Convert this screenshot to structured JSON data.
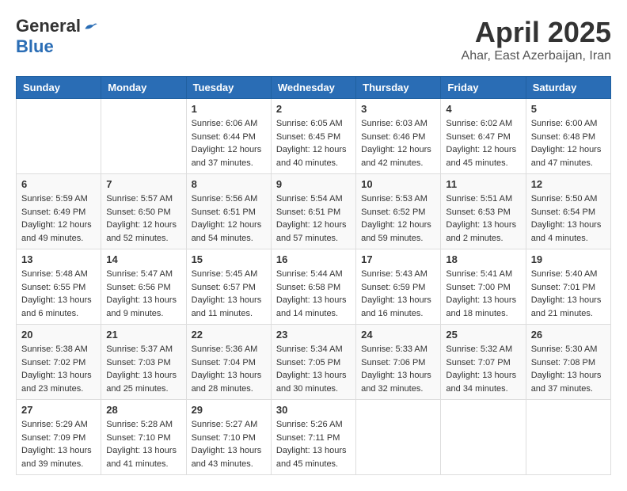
{
  "header": {
    "logo_general": "General",
    "logo_blue": "Blue",
    "month_year": "April 2025",
    "location": "Ahar, East Azerbaijan, Iran"
  },
  "calendar": {
    "days_of_week": [
      "Sunday",
      "Monday",
      "Tuesday",
      "Wednesday",
      "Thursday",
      "Friday",
      "Saturday"
    ],
    "weeks": [
      [
        {
          "day": "",
          "info": ""
        },
        {
          "day": "",
          "info": ""
        },
        {
          "day": "1",
          "info": "Sunrise: 6:06 AM\nSunset: 6:44 PM\nDaylight: 12 hours and 37 minutes."
        },
        {
          "day": "2",
          "info": "Sunrise: 6:05 AM\nSunset: 6:45 PM\nDaylight: 12 hours and 40 minutes."
        },
        {
          "day": "3",
          "info": "Sunrise: 6:03 AM\nSunset: 6:46 PM\nDaylight: 12 hours and 42 minutes."
        },
        {
          "day": "4",
          "info": "Sunrise: 6:02 AM\nSunset: 6:47 PM\nDaylight: 12 hours and 45 minutes."
        },
        {
          "day": "5",
          "info": "Sunrise: 6:00 AM\nSunset: 6:48 PM\nDaylight: 12 hours and 47 minutes."
        }
      ],
      [
        {
          "day": "6",
          "info": "Sunrise: 5:59 AM\nSunset: 6:49 PM\nDaylight: 12 hours and 49 minutes."
        },
        {
          "day": "7",
          "info": "Sunrise: 5:57 AM\nSunset: 6:50 PM\nDaylight: 12 hours and 52 minutes."
        },
        {
          "day": "8",
          "info": "Sunrise: 5:56 AM\nSunset: 6:51 PM\nDaylight: 12 hours and 54 minutes."
        },
        {
          "day": "9",
          "info": "Sunrise: 5:54 AM\nSunset: 6:51 PM\nDaylight: 12 hours and 57 minutes."
        },
        {
          "day": "10",
          "info": "Sunrise: 5:53 AM\nSunset: 6:52 PM\nDaylight: 12 hours and 59 minutes."
        },
        {
          "day": "11",
          "info": "Sunrise: 5:51 AM\nSunset: 6:53 PM\nDaylight: 13 hours and 2 minutes."
        },
        {
          "day": "12",
          "info": "Sunrise: 5:50 AM\nSunset: 6:54 PM\nDaylight: 13 hours and 4 minutes."
        }
      ],
      [
        {
          "day": "13",
          "info": "Sunrise: 5:48 AM\nSunset: 6:55 PM\nDaylight: 13 hours and 6 minutes."
        },
        {
          "day": "14",
          "info": "Sunrise: 5:47 AM\nSunset: 6:56 PM\nDaylight: 13 hours and 9 minutes."
        },
        {
          "day": "15",
          "info": "Sunrise: 5:45 AM\nSunset: 6:57 PM\nDaylight: 13 hours and 11 minutes."
        },
        {
          "day": "16",
          "info": "Sunrise: 5:44 AM\nSunset: 6:58 PM\nDaylight: 13 hours and 14 minutes."
        },
        {
          "day": "17",
          "info": "Sunrise: 5:43 AM\nSunset: 6:59 PM\nDaylight: 13 hours and 16 minutes."
        },
        {
          "day": "18",
          "info": "Sunrise: 5:41 AM\nSunset: 7:00 PM\nDaylight: 13 hours and 18 minutes."
        },
        {
          "day": "19",
          "info": "Sunrise: 5:40 AM\nSunset: 7:01 PM\nDaylight: 13 hours and 21 minutes."
        }
      ],
      [
        {
          "day": "20",
          "info": "Sunrise: 5:38 AM\nSunset: 7:02 PM\nDaylight: 13 hours and 23 minutes."
        },
        {
          "day": "21",
          "info": "Sunrise: 5:37 AM\nSunset: 7:03 PM\nDaylight: 13 hours and 25 minutes."
        },
        {
          "day": "22",
          "info": "Sunrise: 5:36 AM\nSunset: 7:04 PM\nDaylight: 13 hours and 28 minutes."
        },
        {
          "day": "23",
          "info": "Sunrise: 5:34 AM\nSunset: 7:05 PM\nDaylight: 13 hours and 30 minutes."
        },
        {
          "day": "24",
          "info": "Sunrise: 5:33 AM\nSunset: 7:06 PM\nDaylight: 13 hours and 32 minutes."
        },
        {
          "day": "25",
          "info": "Sunrise: 5:32 AM\nSunset: 7:07 PM\nDaylight: 13 hours and 34 minutes."
        },
        {
          "day": "26",
          "info": "Sunrise: 5:30 AM\nSunset: 7:08 PM\nDaylight: 13 hours and 37 minutes."
        }
      ],
      [
        {
          "day": "27",
          "info": "Sunrise: 5:29 AM\nSunset: 7:09 PM\nDaylight: 13 hours and 39 minutes."
        },
        {
          "day": "28",
          "info": "Sunrise: 5:28 AM\nSunset: 7:10 PM\nDaylight: 13 hours and 41 minutes."
        },
        {
          "day": "29",
          "info": "Sunrise: 5:27 AM\nSunset: 7:10 PM\nDaylight: 13 hours and 43 minutes."
        },
        {
          "day": "30",
          "info": "Sunrise: 5:26 AM\nSunset: 7:11 PM\nDaylight: 13 hours and 45 minutes."
        },
        {
          "day": "",
          "info": ""
        },
        {
          "day": "",
          "info": ""
        },
        {
          "day": "",
          "info": ""
        }
      ]
    ]
  }
}
